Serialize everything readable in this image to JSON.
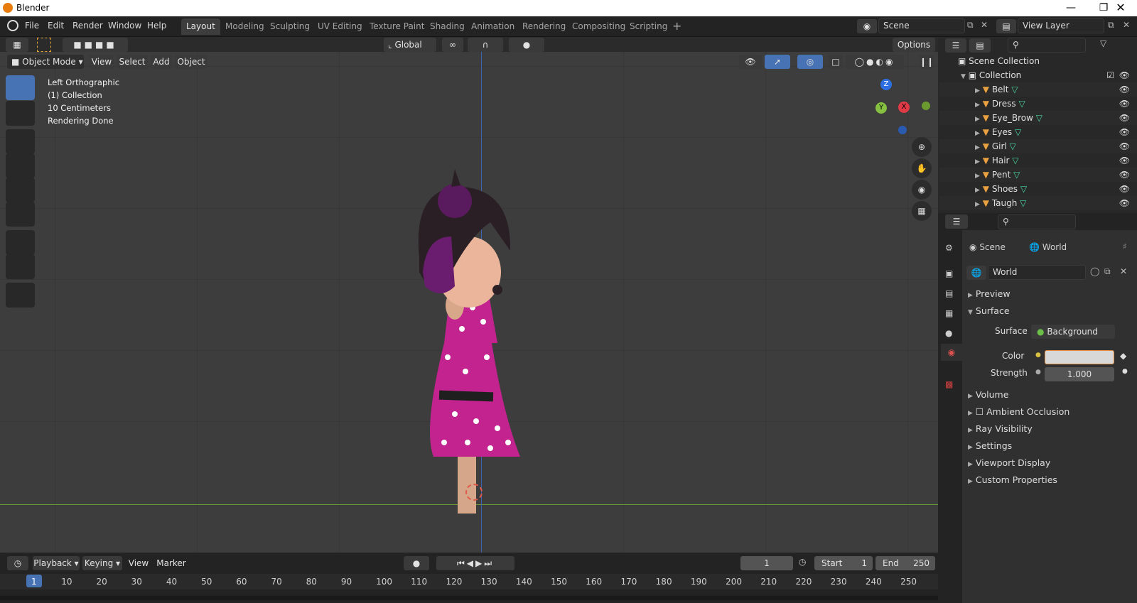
{
  "window": {
    "title": "Blender"
  },
  "menubar": {
    "items": [
      "File",
      "Edit",
      "Render",
      "Window",
      "Help"
    ]
  },
  "workspaces": [
    "Layout",
    "Modeling",
    "Sculpting",
    "UV Editing",
    "Texture Paint",
    "Shading",
    "Animation",
    "Rendering",
    "Compositing",
    "Scripting"
  ],
  "scene": {
    "name": "Scene",
    "view_layer": "View Layer"
  },
  "toolheader": {
    "orientation": "Global",
    "options": "Options"
  },
  "viewport": {
    "mode": "Object Mode",
    "menus": [
      "View",
      "Select",
      "Add",
      "Object"
    ],
    "overlay": [
      "Left Orthographic",
      "(1) Collection",
      "10 Centimeters",
      "Rendering Done"
    ],
    "gizmo": {
      "z": "Z",
      "y": "Y",
      "x": "X"
    }
  },
  "outliner": {
    "root": "Scene Collection",
    "collection": "Collection",
    "objects": [
      "Belt",
      "Dress",
      "Eye_Brow",
      "Eyes",
      "Girl",
      "Hair",
      "Pent",
      "Shoes",
      "Taugh"
    ]
  },
  "properties": {
    "breadcrumb_scene": "Scene",
    "breadcrumb_world": "World",
    "world_name": "World",
    "sections": {
      "preview": "Preview",
      "surface": "Surface",
      "volume": "Volume",
      "ao": "Ambient Occlusion",
      "ray": "Ray Visibility",
      "settings": "Settings",
      "viewport_display": "Viewport Display",
      "custom": "Custom Properties"
    },
    "surface_label": "Surface",
    "surface_value": "Background",
    "color_label": "Color",
    "strength_label": "Strength",
    "strength_value": "1.000"
  },
  "timeline": {
    "menus": [
      "Playback",
      "Keying",
      "View",
      "Marker"
    ],
    "current_frame": "1",
    "start_label": "Start",
    "start": "1",
    "end_label": "End",
    "end": "250",
    "ruler": [
      "1",
      "10",
      "20",
      "30",
      "40",
      "50",
      "60",
      "70",
      "80",
      "90",
      "100",
      "110",
      "120",
      "130",
      "140",
      "150",
      "160",
      "170",
      "180",
      "190",
      "200",
      "210",
      "220",
      "230",
      "240",
      "250"
    ]
  },
  "colors": {
    "accent": "#4772b3",
    "dress": "#c2238e",
    "hair": "#6a1d6e"
  }
}
